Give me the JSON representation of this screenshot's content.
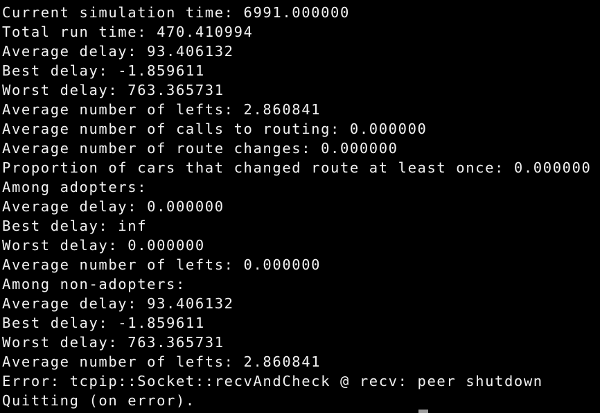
{
  "terminal": {
    "lines": [
      "Current simulation time: 6991.000000",
      "Total run time: 470.410994",
      "Average delay: 93.406132",
      "Best delay: -1.859611",
      "Worst delay: 763.365731",
      "Average number of lefts: 2.860841",
      "Average number of calls to routing: 0.000000",
      "Average number of route changes: 0.000000",
      "Proportion of cars that changed route at least once: 0.000000",
      "Among adopters:",
      "Average delay: 0.000000",
      "Best delay: inf",
      "Worst delay: 0.000000",
      "Average number of lefts: 0.000000",
      "Among non-adopters:",
      "Average delay: 93.406132",
      "Best delay: -1.859611",
      "Worst delay: 763.365731",
      "Average number of lefts: 2.860841",
      "Error: tcpip::Socket::recvAndCheck @ recv: peer shutdown",
      "Quitting (on error)."
    ],
    "colors": {
      "background": "#000000",
      "text": "#f2f2f2",
      "cursor": "#9a9a9a"
    }
  }
}
